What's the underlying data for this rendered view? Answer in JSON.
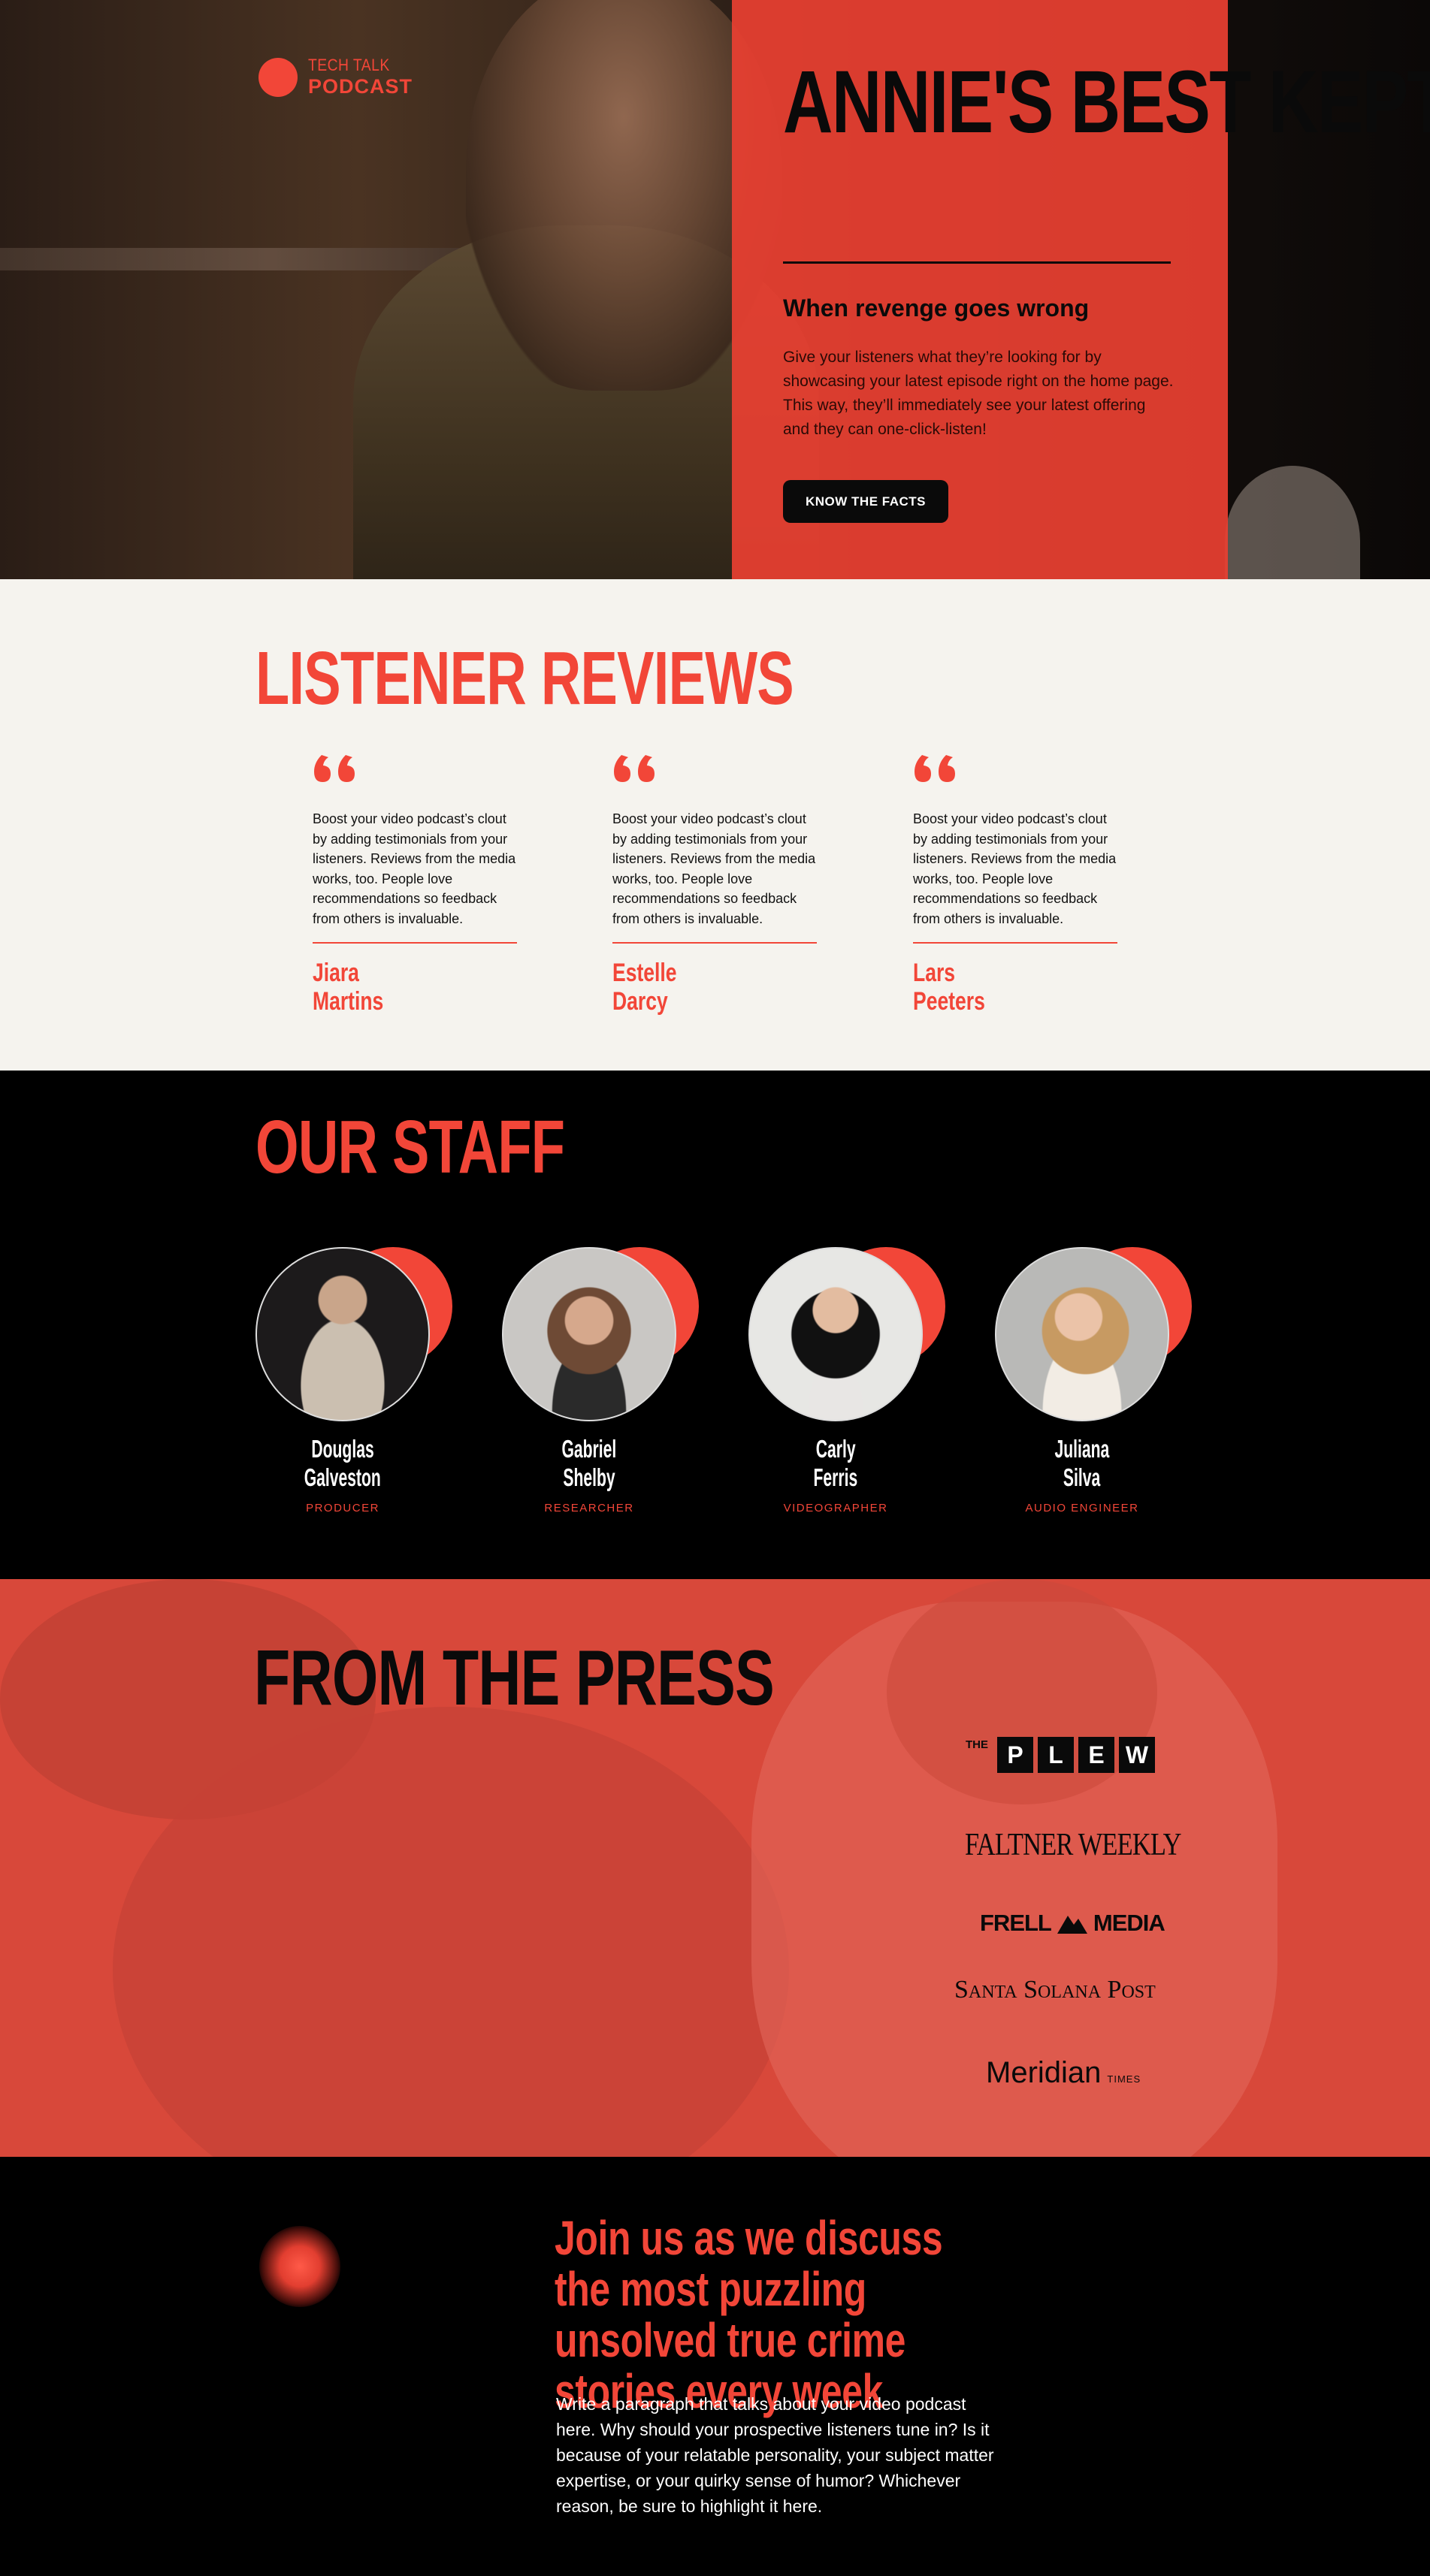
{
  "brand": {
    "line1": "TECH TALK",
    "line2": "PODCAST",
    "accent": "#f24638"
  },
  "hero": {
    "title": "ANNIE'S BEST KEPT SECRET",
    "subtitle": "When revenge goes wrong",
    "description": "Give your listeners what they’re looking for by showcasing your latest episode right on the home page. This way, they’ll immediately see your latest offering and they can one-click-listen!",
    "cta_label": "KNOW THE FACTS"
  },
  "reviews": {
    "title": "LISTENER REVIEWS",
    "items": [
      {
        "text": "Boost your video podcast’s clout by adding testimonials from your listeners. Reviews from the media works, too. People love recommendations so feedback from others is invaluable.",
        "first": "Jiara",
        "last": "Martins"
      },
      {
        "text": "Boost your video podcast’s clout by adding testimonials from your listeners. Reviews from the media works, too. People love recommendations so feedback from others is invaluable.",
        "first": "Estelle",
        "last": "Darcy"
      },
      {
        "text": "Boost your video podcast’s clout by adding testimonials from your listeners. Reviews from the media works, too. People love recommendations so feedback from others is invaluable.",
        "first": "Lars",
        "last": "Peeters"
      }
    ]
  },
  "staff": {
    "title": "OUR STAFF",
    "members": [
      {
        "first": "Douglas",
        "last": "Galveston",
        "role": "PRODUCER"
      },
      {
        "first": "Gabriel",
        "last": "Shelby",
        "role": "RESEARCHER"
      },
      {
        "first": "Carly",
        "last": "Ferris",
        "role": "VIDEOGRAPHER"
      },
      {
        "first": "Juliana",
        "last": "Silva",
        "role": "AUDIO ENGINEER"
      }
    ]
  },
  "press": {
    "title": "FROM THE PRESS",
    "logos": {
      "plew_prefix": "THE",
      "plew_letters": [
        "P",
        "L",
        "E",
        "W"
      ],
      "faltner": "FALTNER WEEKLY",
      "frell_left": "FRELL",
      "frell_right": "MEDIA",
      "santa": "Santa Solana Post",
      "meridian": "Meridian",
      "meridian_suffix": "TIMES"
    }
  },
  "join": {
    "title": "Join us as we discuss the most puzzling unsolved true crime stories every week",
    "description": "Write a paragraph that talks about your video podcast here. Why should your prospective listeners tune in? Is it because of your relatable personality, your subject matter expertise, or your quirky sense of humor? Whichever reason, be sure to highlight it here."
  }
}
